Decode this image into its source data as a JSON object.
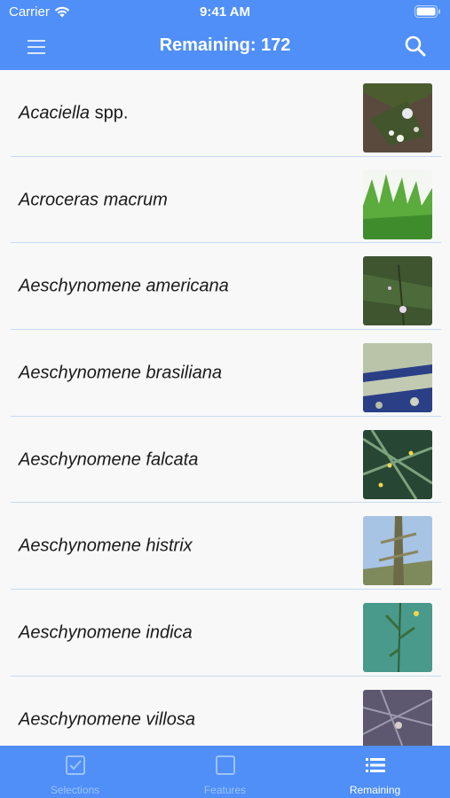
{
  "status": {
    "carrier": "Carrier",
    "time": "9:41 AM"
  },
  "header": {
    "title": "Remaining: 172"
  },
  "items": [
    {
      "genus": "Acaciella",
      "suffix": " spp.",
      "thumb": "img-1"
    },
    {
      "genus": "Acroceras macrum",
      "suffix": "",
      "thumb": "img-2"
    },
    {
      "genus": "Aeschynomene americana",
      "suffix": "",
      "thumb": "img-3"
    },
    {
      "genus": "Aeschynomene brasiliana",
      "suffix": "",
      "thumb": "img-4"
    },
    {
      "genus": "Aeschynomene falcata",
      "suffix": "",
      "thumb": "img-5"
    },
    {
      "genus": "Aeschynomene histrix",
      "suffix": "",
      "thumb": "img-6"
    },
    {
      "genus": "Aeschynomene indica",
      "suffix": "",
      "thumb": "img-7"
    },
    {
      "genus": "Aeschynomene villosa",
      "suffix": "",
      "thumb": "img-8"
    }
  ],
  "tabs": [
    {
      "label": "Selections",
      "icon": "checkbox-icon",
      "active": false
    },
    {
      "label": "Features",
      "icon": "square-icon",
      "active": false
    },
    {
      "label": "Remaining",
      "icon": "list-icon",
      "active": true
    }
  ],
  "colors": {
    "accent": "#4f8ff7",
    "tab_inactive": "#9ec2fb",
    "divider": "#c9daf3"
  }
}
